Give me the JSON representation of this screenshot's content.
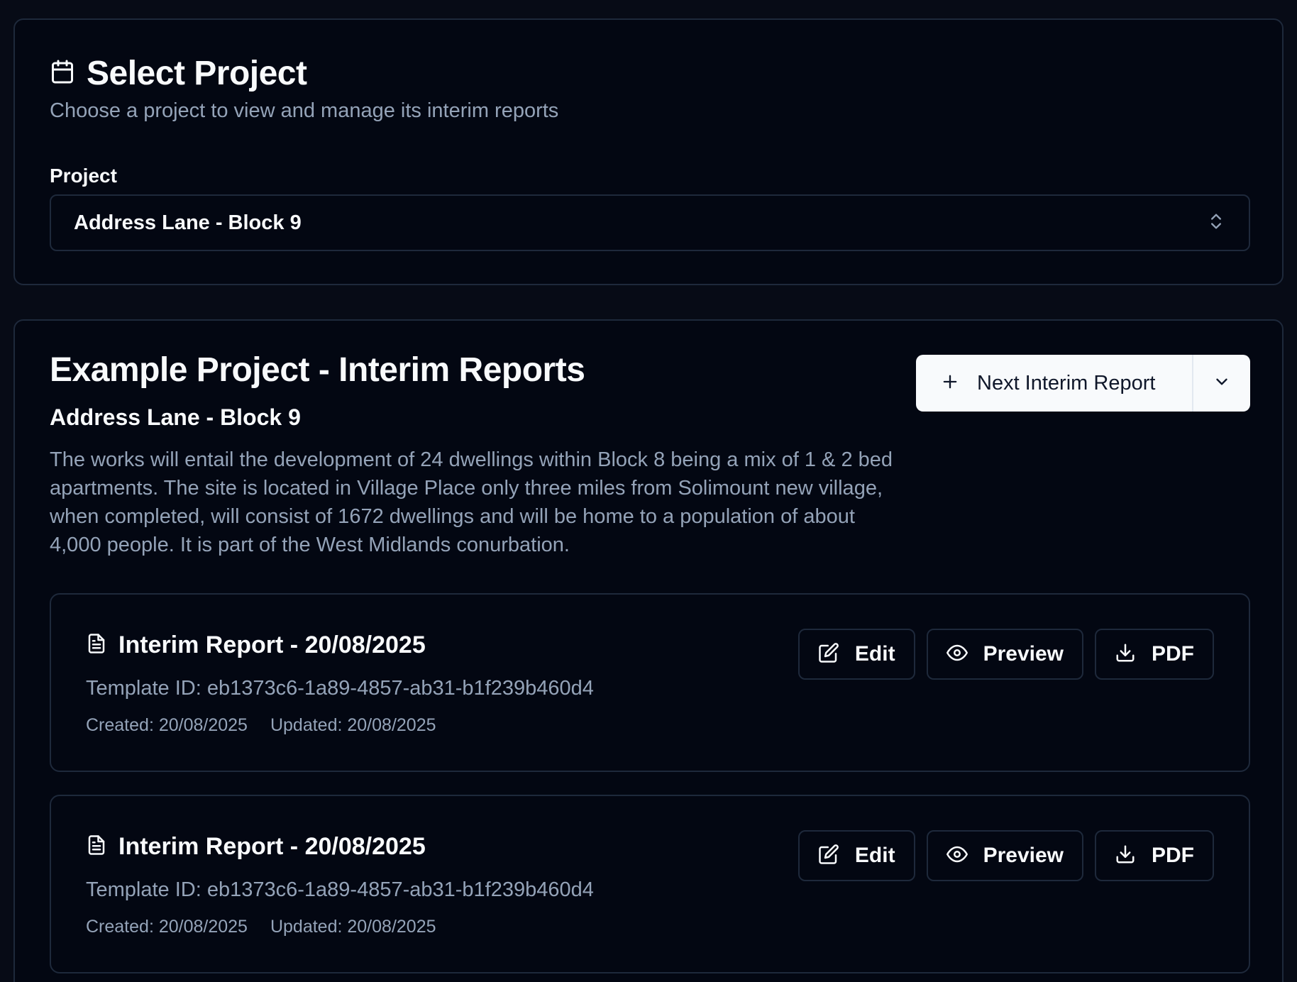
{
  "select_card": {
    "title": "Select Project",
    "description": "Choose a project to view and manage its interim reports",
    "field_label": "Project",
    "selected_project": "Address Lane - Block 9",
    "icons": {
      "title": "calendar-icon",
      "select": "chevrons-up-down-icon"
    }
  },
  "reports_card": {
    "title": "Example Project - Interim Reports",
    "subtitle": "Address Lane - Block 9",
    "description": "The works will entail the development of 24 dwellings within Block 8 being a mix of 1 & 2 bed apartments. The site is located in Village Place only three miles from Solimount new village, when completed, will consist of 1672 dwellings and will be home to a population of about 4,000 people. It is part of the West Midlands conurbation.",
    "next_button_label": "Next Interim Report",
    "reports": [
      {
        "title": "Interim Report - 20/08/2025",
        "template": "Template ID: eb1373c6-1a89-4857-ab31-b1f239b460d4",
        "created": "Created: 20/08/2025",
        "updated": "Updated: 20/08/2025",
        "actions": {
          "edit": "Edit",
          "preview": "Preview",
          "pdf": "PDF"
        }
      },
      {
        "title": "Interim Report - 20/08/2025",
        "template": "Template ID: eb1373c6-1a89-4857-ab31-b1f239b460d4",
        "created": "Created: 20/08/2025",
        "updated": "Updated: 20/08/2025",
        "actions": {
          "edit": "Edit",
          "preview": "Preview",
          "pdf": "PDF"
        }
      }
    ]
  },
  "colors": {
    "background": "#070b16",
    "card": "#030712",
    "border": "#1e293b",
    "text": "#f8fafc",
    "muted": "#94a3b8",
    "primary_button": "#f8fafc"
  }
}
